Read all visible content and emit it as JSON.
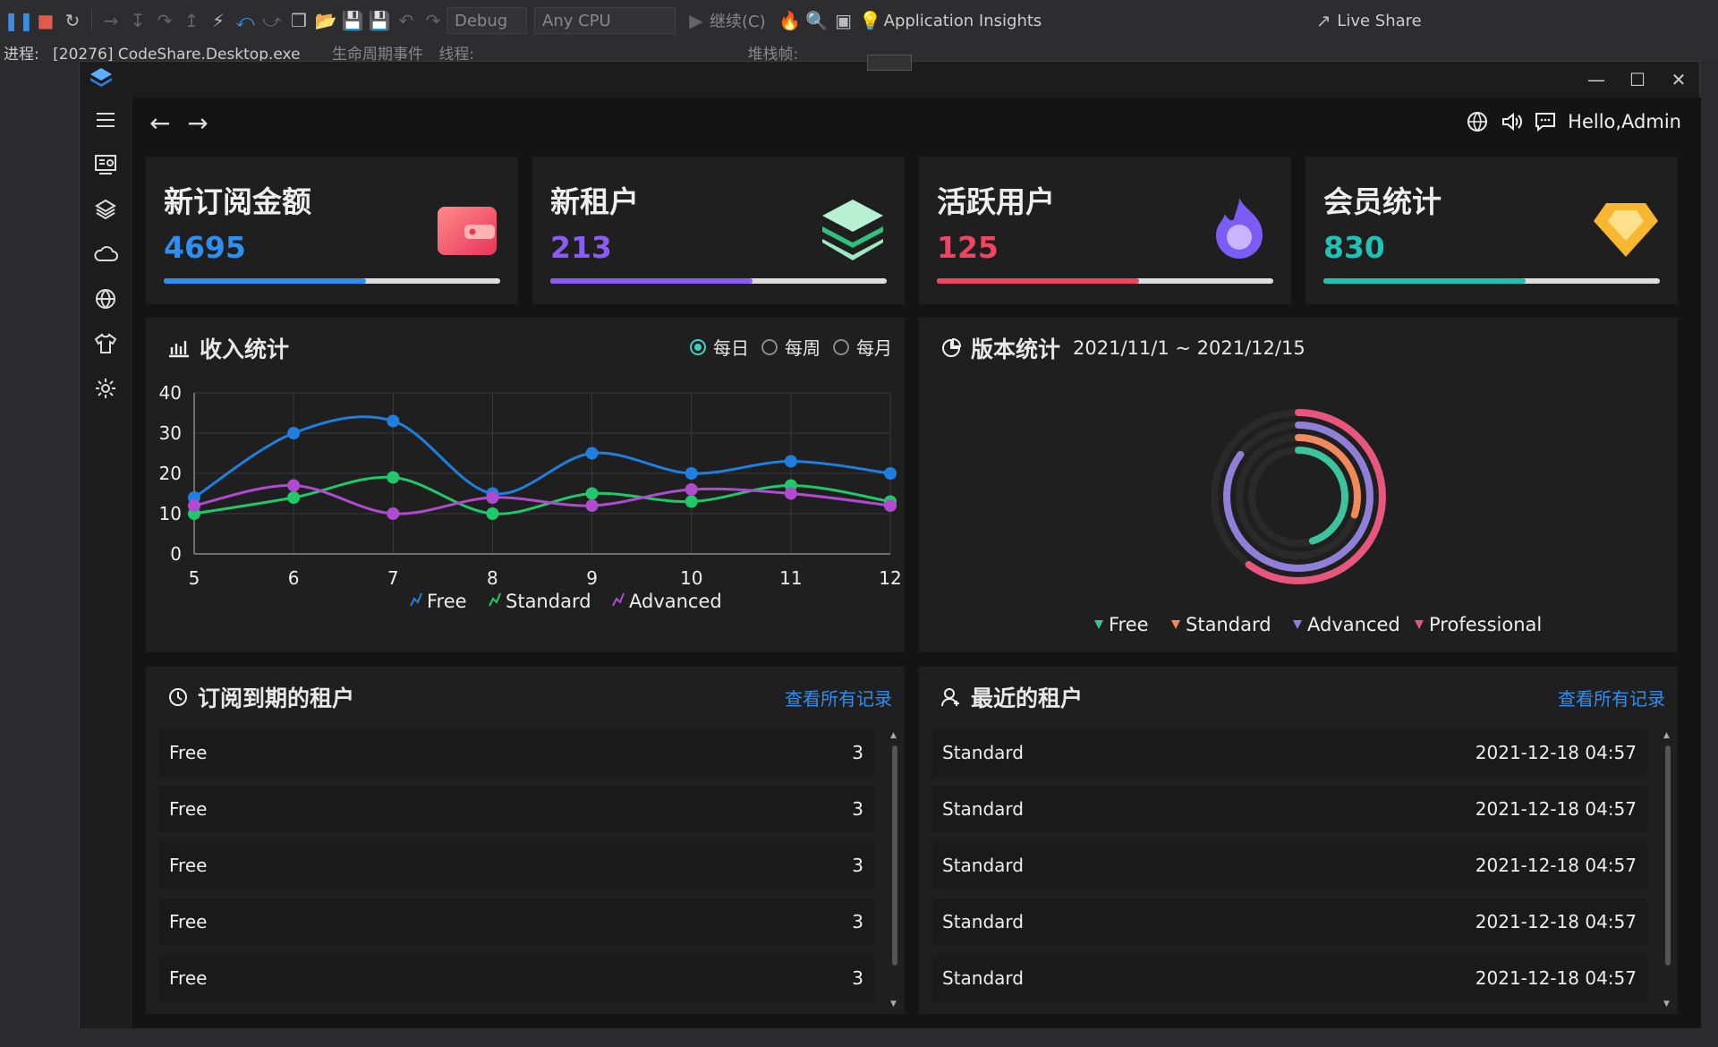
{
  "vs": {
    "config_combo": "Debug",
    "platform_combo": "Any CPU",
    "continue_label": "继续(C)",
    "insights_label": "Application Insights",
    "live_share": "Live Share",
    "process_label": "进程:",
    "process_value": "[20276] CodeShare.Desktop.exe",
    "lifecycle_label": "生命周期事件",
    "thread_label": "线程:",
    "stack_label": "堆栈帧:"
  },
  "header": {
    "greeting": "Hello,Admin"
  },
  "cards": [
    {
      "title": "新订阅金额",
      "value": "4695",
      "color": "#2f8ff0",
      "fill": 0.6
    },
    {
      "title": "新租户",
      "value": "213",
      "color": "#8b5cf6",
      "fill": 0.6
    },
    {
      "title": "活跃用户",
      "value": "125",
      "color": "#ef4560",
      "fill": 0.6
    },
    {
      "title": "会员统计",
      "value": "830",
      "color": "#1fc2b5",
      "fill": 0.6
    }
  ],
  "income": {
    "title": "收入统计",
    "radios": [
      {
        "label": "每日",
        "selected": true
      },
      {
        "label": "每周",
        "selected": false
      },
      {
        "label": "每月",
        "selected": false
      }
    ]
  },
  "chart_data": [
    {
      "type": "line",
      "x": [
        5,
        6,
        7,
        8,
        9,
        10,
        11,
        12
      ],
      "ylim": [
        0,
        40
      ],
      "yticks": [
        0,
        10,
        20,
        30,
        40
      ],
      "grid": true,
      "legend": "bottom",
      "series": [
        {
          "name": "Free",
          "color": "#1e7fe0",
          "values": [
            14,
            30,
            33,
            15,
            25,
            20,
            23,
            20
          ]
        },
        {
          "name": "Standard",
          "color": "#20c86a",
          "values": [
            10,
            14,
            19,
            10,
            15,
            13,
            17,
            13
          ]
        },
        {
          "name": "Advanced",
          "color": "#b04ad0",
          "values": [
            12,
            17,
            10,
            14,
            12,
            16,
            15,
            12
          ]
        }
      ]
    },
    {
      "type": "pie",
      "variant": "concentric-rings",
      "legend": "bottom",
      "series": [
        {
          "name": "Free",
          "color": "#3cc29c",
          "fraction": 0.45
        },
        {
          "name": "Standard",
          "color": "#f08a5d",
          "fraction": 0.3
        },
        {
          "name": "Advanced",
          "color": "#8f7fd6",
          "fraction": 0.85
        },
        {
          "name": "Professional",
          "color": "#e8567e",
          "fraction": 0.6
        }
      ]
    }
  ],
  "version": {
    "title": "版本统计",
    "range": "2021/11/1 ~ 2021/12/15"
  },
  "expiring": {
    "title": "订阅到期的租户",
    "link": "查看所有记录",
    "rows": [
      {
        "name": "Free",
        "count": "3"
      },
      {
        "name": "Free",
        "count": "3"
      },
      {
        "name": "Free",
        "count": "3"
      },
      {
        "name": "Free",
        "count": "3"
      },
      {
        "name": "Free",
        "count": "3"
      }
    ]
  },
  "recent": {
    "title": "最近的租户",
    "link": "查看所有记录",
    "rows": [
      {
        "name": "Standard",
        "time": "2021-12-18 04:57"
      },
      {
        "name": "Standard",
        "time": "2021-12-18 04:57"
      },
      {
        "name": "Standard",
        "time": "2021-12-18 04:57"
      },
      {
        "name": "Standard",
        "time": "2021-12-18 04:57"
      },
      {
        "name": "Standard",
        "time": "2021-12-18 04:57"
      }
    ]
  }
}
